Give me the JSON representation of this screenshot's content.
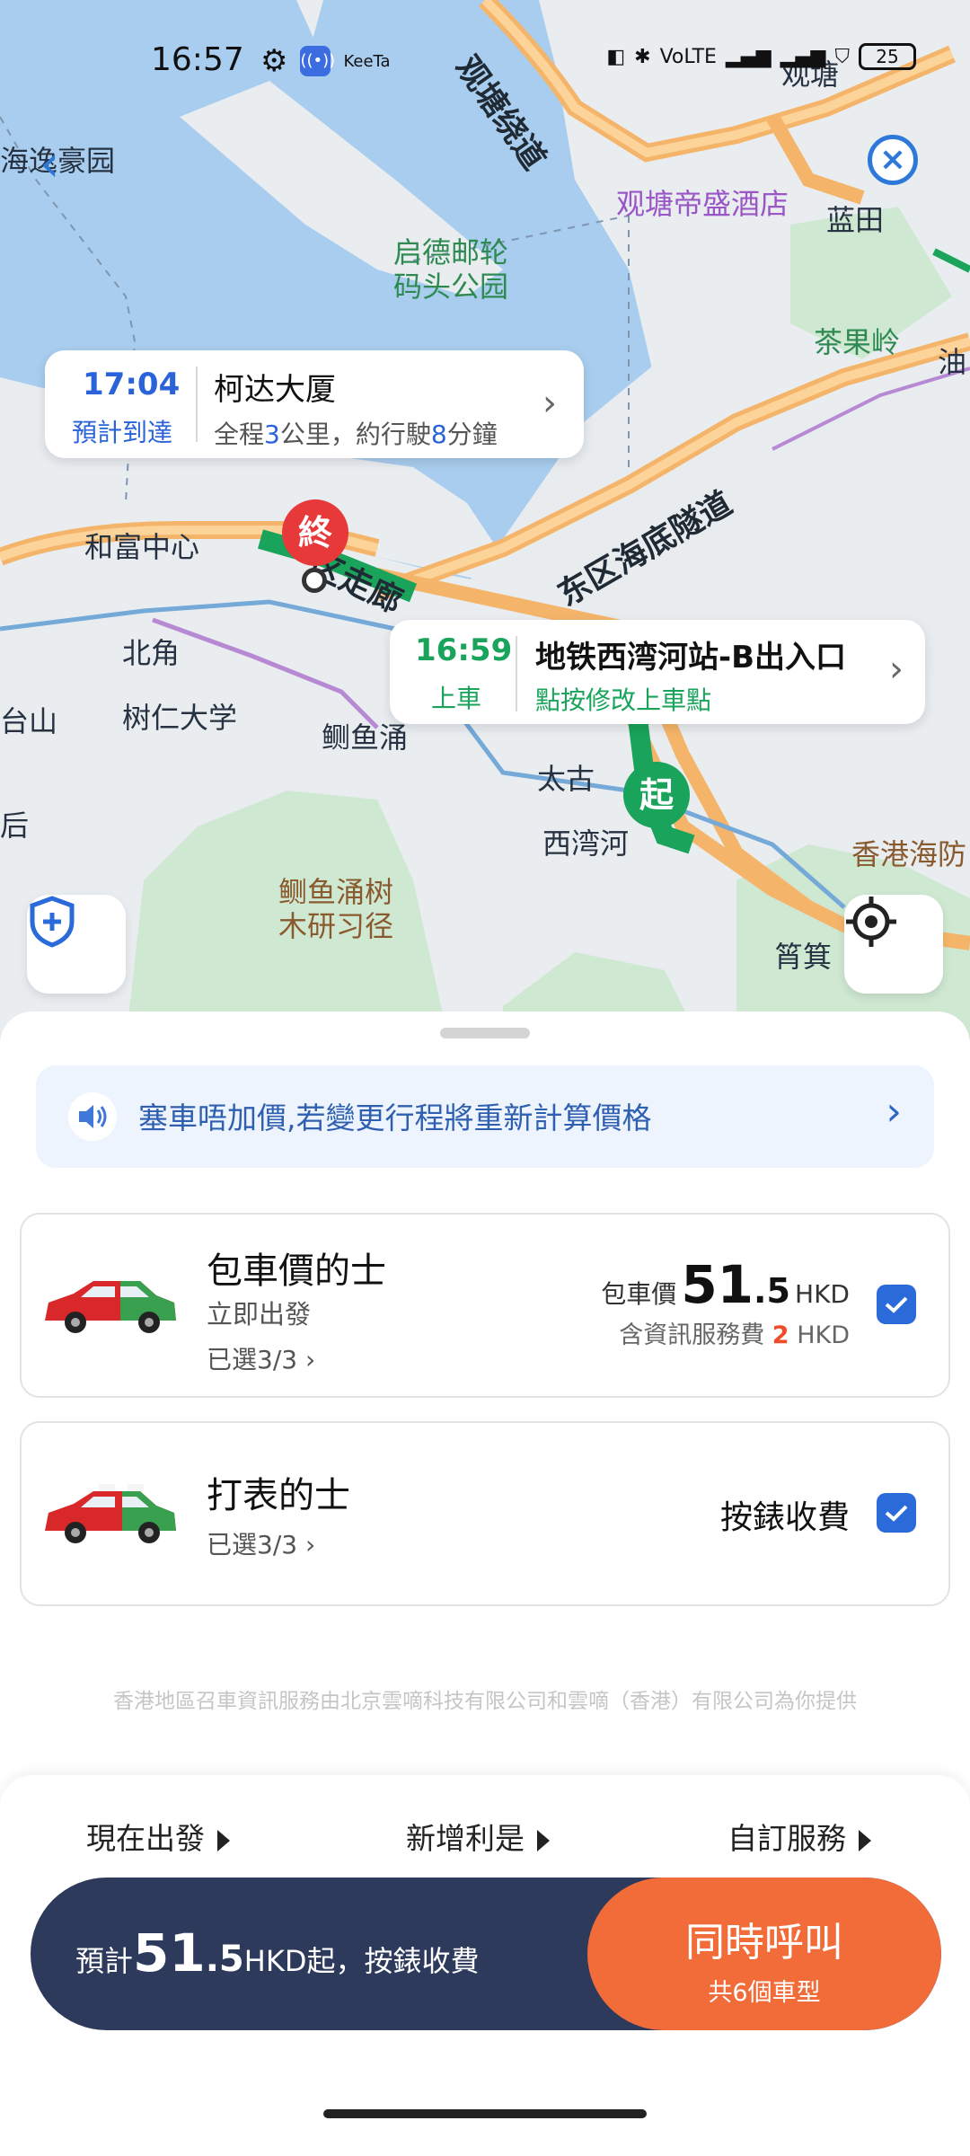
{
  "status_bar": {
    "time": "16:57",
    "app_icon_text": "KeeTa",
    "battery": "25"
  },
  "map": {
    "labels": {
      "guantang_road": "观塘绕道",
      "guantang": "观塘",
      "hotel": "观塘帝盛酒店",
      "lantian": "蓝田",
      "kaideng_park": "启德邮轮码头公园",
      "chaguoling": "茶果岭",
      "you": "油",
      "haiyi": "海逸豪园",
      "guantang_west_road": "观塘西湾河",
      "eastern_tunnel": "东区海底隧道",
      "hefu_center": "和富中心",
      "corridor": "区走廊",
      "beijiao": "北角",
      "shuren": "树仁大学",
      "quayuchong": "鲗鱼涌",
      "taigu": "太古",
      "xiwanhe": "西湾河",
      "taishan": "台山",
      "hou": "后",
      "tree_trail": "鲗鱼涌树木研习径",
      "hk_museum": "香港海防",
      "shaoji": "筲箕"
    },
    "dest_bubble": {
      "time": "17:04",
      "sub": "預計到達",
      "title": "柯达大厦",
      "detail_prefix": "全程",
      "km": "3",
      "detail_mid": "公里，約行駛",
      "minutes": "8",
      "detail_suffix": "分鐘"
    },
    "pickup_bubble": {
      "time": "16:59",
      "sub": "上車",
      "title": "地铁西湾河站-B出入口",
      "hint": "點按修改上車點"
    },
    "end_pin": "終",
    "start_pin": "起"
  },
  "sheet": {
    "notice": "塞車唔加價,若變更行程將重新計算價格",
    "cards": [
      {
        "name": "包車價的士",
        "desc": "立即出發",
        "selected": "已選3/3",
        "price_prefix": "包車價",
        "price_int": "51",
        "price_dec": ".5",
        "currency": "HKD",
        "fee_prefix": "含資訊服務費",
        "fee": "2",
        "fee_currency": "HKD"
      },
      {
        "name": "打表的士",
        "selected": "已選3/3",
        "price_text": "按錶收費"
      }
    ],
    "provider": "香港地區召車資訊服務由北京雲嘀科技有限公司和雲嘀（香港）有限公司為你提供",
    "options": [
      "現在出發",
      "新增利是",
      "自訂服務"
    ],
    "cta": {
      "est_label": "預計",
      "est_int": "51",
      "est_dec": ".5",
      "est_suffix": "HKD起，按錶收費",
      "call_main": "同時呼叫",
      "call_sub": "共6個車型"
    }
  },
  "colors": {
    "accent_blue": "#2a6ad9",
    "route_green": "#1aa35a",
    "cta_dark": "#2d3a5c",
    "cta_orange": "#f26c3a",
    "fee_red": "#f04c2c"
  }
}
